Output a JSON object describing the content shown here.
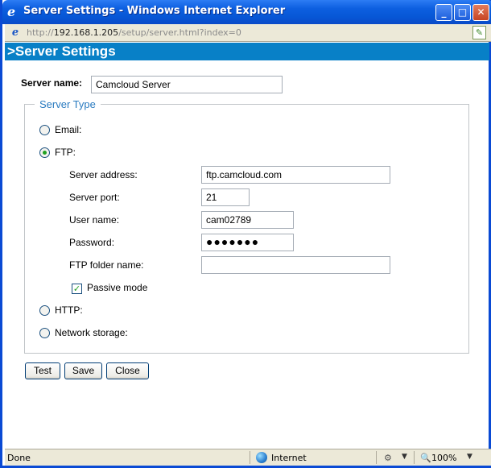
{
  "window": {
    "title": "Server Settings - Windows Internet Explorer",
    "minimize": "_",
    "maximize": "□",
    "close": "✕"
  },
  "address": {
    "prefix": "http://",
    "host": "192.168.1.205",
    "path": "/setup/server.html?index=0"
  },
  "page": {
    "header": ">Server Settings",
    "server_name_label": "Server name:",
    "server_name_value": "Camcloud Server",
    "server_type_legend": "Server Type",
    "types": {
      "email": "Email:",
      "ftp": "FTP:",
      "http": "HTTP:",
      "network_storage": "Network storage:"
    },
    "selected_type": "ftp",
    "ftp": {
      "address_label": "Server address:",
      "address_value": "ftp.camcloud.com",
      "port_label": "Server port:",
      "port_value": "21",
      "user_label": "User name:",
      "user_value": "cam02789",
      "password_label": "Password:",
      "password_value": "●●●●●●●",
      "folder_label": "FTP folder name:",
      "folder_value": "",
      "passive_label": "Passive mode",
      "passive_checked": true
    },
    "buttons": {
      "test": "Test",
      "save": "Save",
      "close": "Close"
    }
  },
  "status": {
    "text": "Done",
    "zone": "Internet",
    "zoom": "100%"
  },
  "colors": {
    "title_bar": "#0757d6",
    "header_bar": "#0880c7",
    "legend": "#2a7bc0",
    "radio_checked": "#21a121"
  },
  "icons": [
    "ie-icon",
    "page-icon",
    "globe-icon",
    "zoom-icon",
    "checkmark-icon"
  ]
}
